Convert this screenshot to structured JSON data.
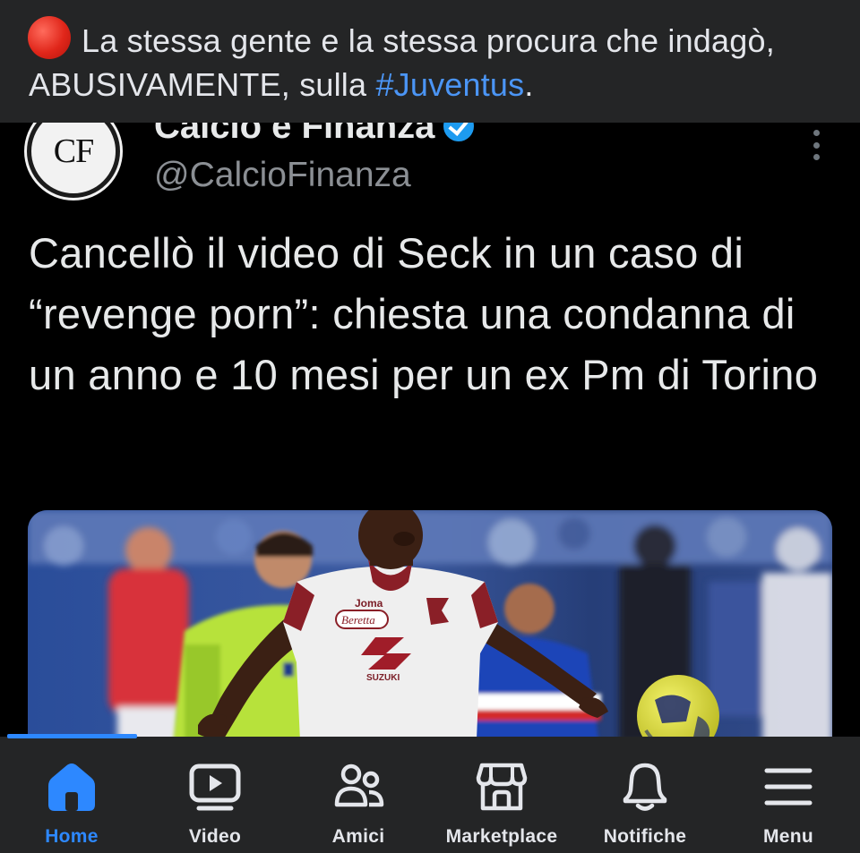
{
  "post": {
    "caption_before": "La stessa gente e la stessa procura che indagò, ABUSIVAMENTE, sulla ",
    "hashtag": "#Juventus",
    "caption_after": ".",
    "emoji_icon": "red-circle-icon"
  },
  "tweet": {
    "avatar_text": "CF",
    "display_name": "Calcio e Finanza",
    "handle": "@CalcioFinanza",
    "text": "Cancellò il video di Seck in un caso di “revenge porn”: chiesta una condanna di un anno e 10 mesi per un ex Pm di Torino",
    "photo": {
      "jersey_sponsor": "Beretta",
      "jersey_brand": "Joma",
      "jersey_chest": "SUZUKI"
    }
  },
  "tabbar": {
    "active_color": "#2d88ff",
    "items": [
      {
        "label": "Home",
        "icon": "home-icon",
        "active": true
      },
      {
        "label": "Video",
        "icon": "video-icon",
        "active": false
      },
      {
        "label": "Amici",
        "icon": "friends-icon",
        "active": false
      },
      {
        "label": "Marketplace",
        "icon": "marketplace-icon",
        "active": false
      },
      {
        "label": "Notifiche",
        "icon": "bell-icon",
        "active": false
      },
      {
        "label": "Menu",
        "icon": "menu-icon",
        "active": false
      }
    ]
  }
}
